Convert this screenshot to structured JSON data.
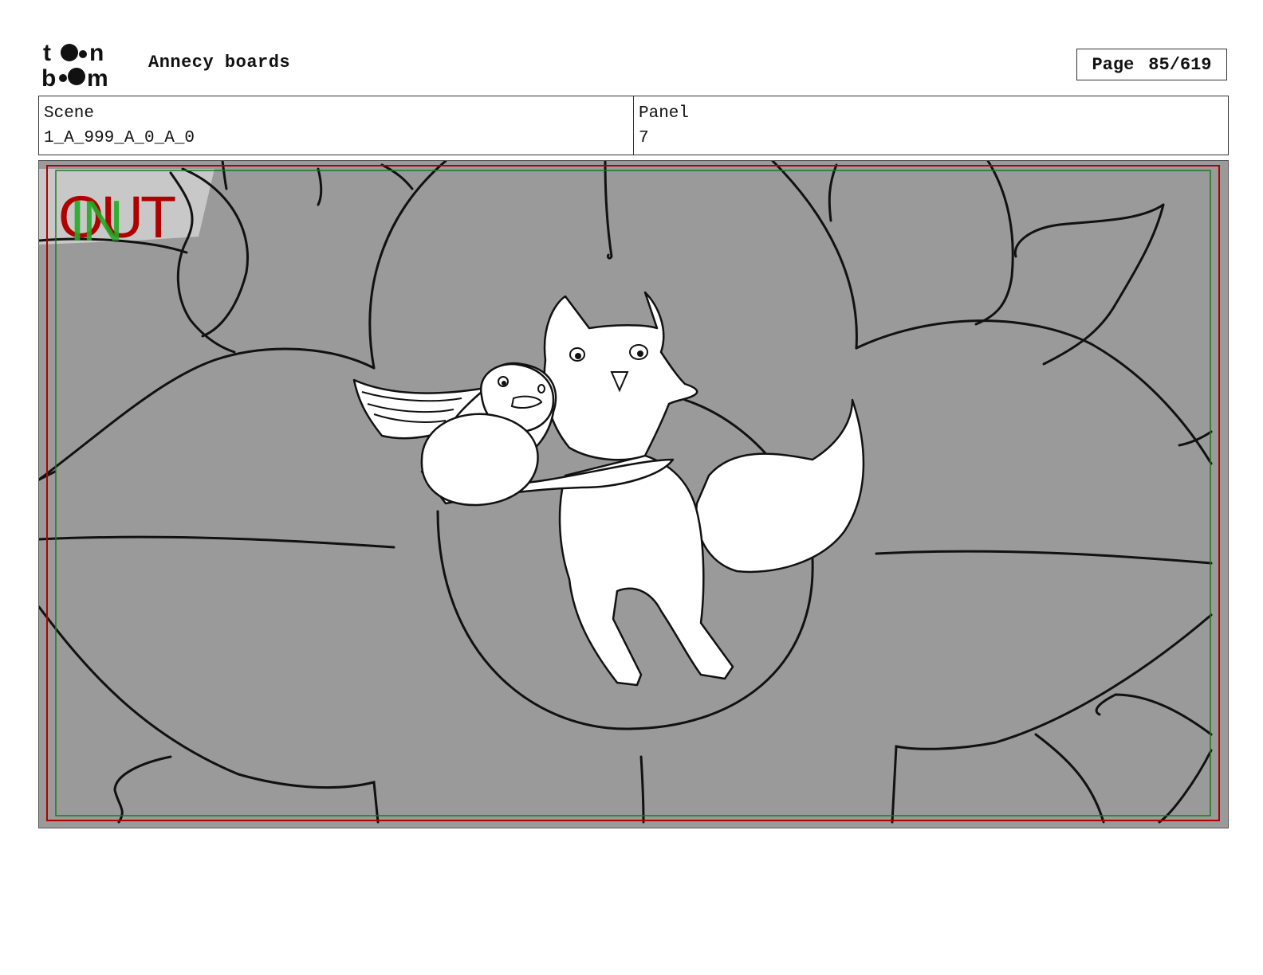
{
  "header": {
    "logo_text": "toon boom",
    "title": "Annecy boards",
    "page_label": "Page",
    "page_value": "85/619"
  },
  "info": {
    "scene_label": "Scene",
    "scene_value": "1_A_999_A_0_A_0",
    "panel_label": "Panel",
    "panel_value": "7"
  },
  "panel_image": {
    "overlay_out_text": "OUT",
    "overlay_in_text": "IN",
    "colors": {
      "background": "#9a9a9a",
      "outline": "#111111",
      "safe_frame_red": "#b00000",
      "safe_frame_green": "#1a7a1a",
      "overlay_out": "#b00000",
      "overlay_in": "#22aa22"
    }
  }
}
